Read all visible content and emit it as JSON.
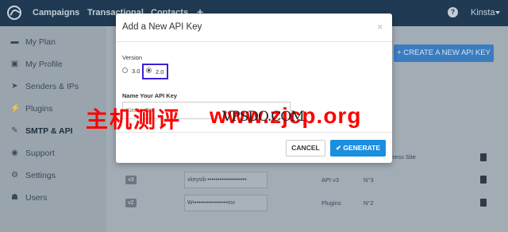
{
  "header": {
    "nav": [
      "Campaigns",
      "Transactional",
      "Contacts"
    ],
    "add_symbol": "+",
    "help_symbol": "?",
    "user_name": "Kinsta"
  },
  "sidebar": {
    "items": [
      {
        "label": "My Plan",
        "icon": "plan-icon"
      },
      {
        "label": "My Profile",
        "icon": "profile-icon"
      },
      {
        "label": "Senders & IPs",
        "icon": "send-icon"
      },
      {
        "label": "Plugins",
        "icon": "plug-icon"
      },
      {
        "label": "SMTP & API",
        "icon": "wrench-icon",
        "active": true
      },
      {
        "label": "Support",
        "icon": "support-icon"
      },
      {
        "label": "Settings",
        "icon": "gear-icon"
      },
      {
        "label": "Users",
        "icon": "users-icon"
      }
    ]
  },
  "main": {
    "create_button": "+ CREATE A NEW API KEY",
    "rows": [
      {
        "version": "v3",
        "key": "xkeysib-••••••••••••••••••••",
        "type": "API v3",
        "number": "N°3"
      },
      {
        "version": "v2",
        "key": "W••••••••••••••••••mv",
        "type": "Plugins",
        "number": "N°2"
      }
    ],
    "partial_text": "rdPress Site"
  },
  "modal": {
    "title": "Add a New API Key",
    "close_symbol": "×",
    "version_label": "Version",
    "options": [
      "3.0",
      "2.0"
    ],
    "selected": "2.0",
    "name_label": "Name Your API Key",
    "name_value": "Kinsta Site",
    "cancel_label": "CANCEL",
    "generate_label": "✔ GENERATE"
  },
  "watermark": {
    "chinese": "主机测评",
    "url": "www.zjcp.org",
    "overlay": "VPSDO.COM"
  },
  "colors": {
    "topbar": "#1f3a52",
    "accent": "#1b8ee0",
    "highlight": "#3b22d6",
    "watermark": "#ff0000"
  }
}
